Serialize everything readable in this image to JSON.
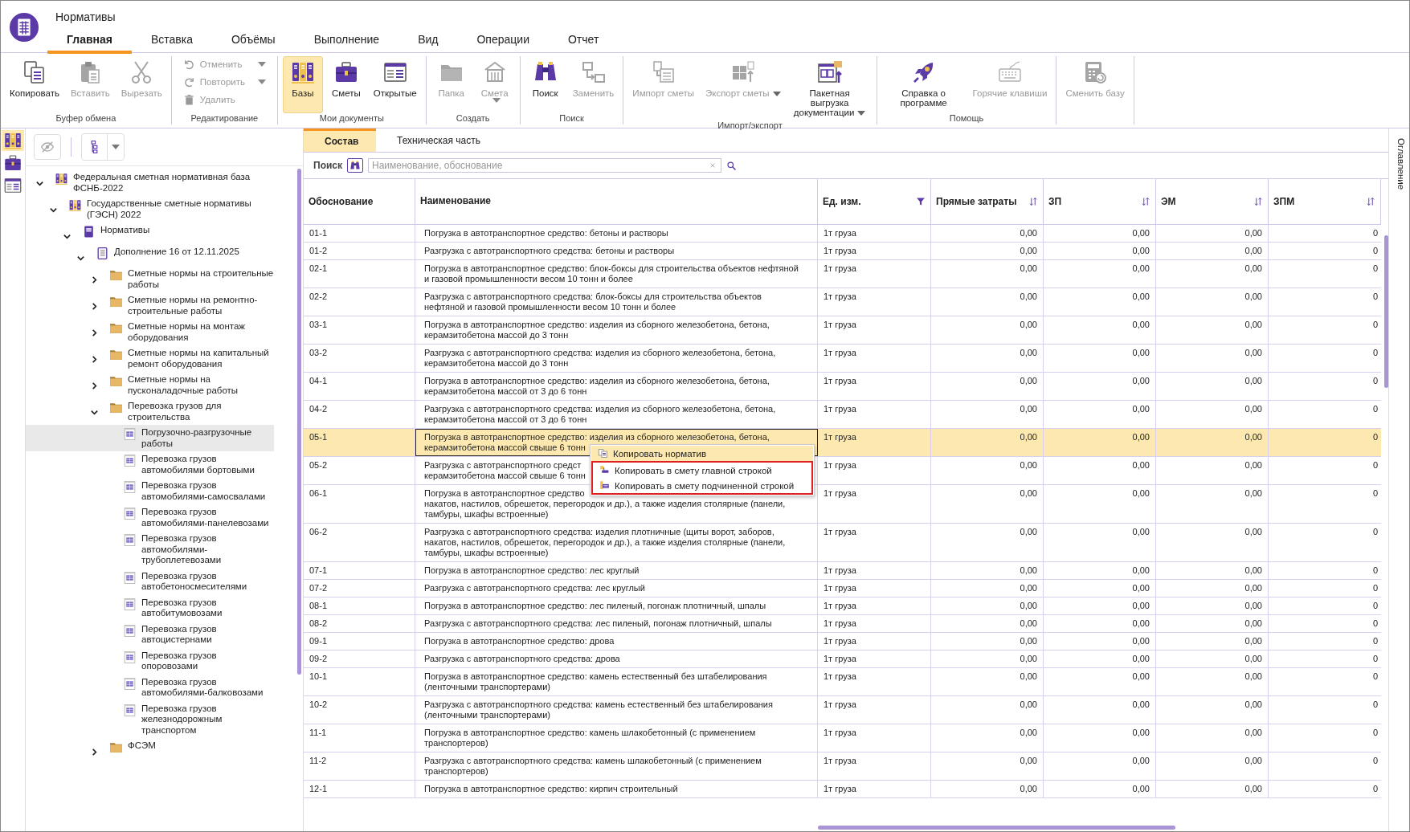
{
  "window": {
    "title": "Нормативы"
  },
  "menu_tabs": [
    {
      "label": "Главная",
      "selected": true
    },
    {
      "label": "Вставка",
      "selected": false
    },
    {
      "label": "Объёмы",
      "selected": false
    },
    {
      "label": "Выполнение",
      "selected": false
    },
    {
      "label": "Вид",
      "selected": false
    },
    {
      "label": "Операции",
      "selected": false
    },
    {
      "label": "Отчет",
      "selected": false
    }
  ],
  "ribbon": [
    {
      "label": "Буфер обмена",
      "kind": "large",
      "buttons": [
        {
          "label": "Копировать",
          "disabled": false,
          "dropdown": false,
          "selected": false
        },
        {
          "label": "Вставить",
          "disabled": true,
          "dropdown": false,
          "selected": false
        },
        {
          "label": "Вырезать",
          "disabled": true,
          "dropdown": false,
          "selected": false
        }
      ]
    },
    {
      "label": "Редактирование",
      "kind": "small",
      "buttons": [
        {
          "label": "Отменить",
          "disabled": true,
          "dropdown": true,
          "selected": false
        },
        {
          "label": "Повторить",
          "disabled": true,
          "dropdown": true,
          "selected": false
        },
        {
          "label": "Удалить",
          "disabled": true,
          "dropdown": false,
          "selected": false
        }
      ]
    },
    {
      "label": "Мои документы",
      "kind": "large",
      "buttons": [
        {
          "label": "Базы",
          "disabled": false,
          "dropdown": false,
          "selected": true
        },
        {
          "label": "Сметы",
          "disabled": false,
          "dropdown": false,
          "selected": false
        },
        {
          "label": "Открытые",
          "disabled": false,
          "dropdown": false,
          "selected": false
        }
      ]
    },
    {
      "label": "Создать",
      "kind": "large",
      "buttons": [
        {
          "label": "Папка",
          "disabled": true,
          "dropdown": false,
          "selected": false
        },
        {
          "label": "Смета",
          "disabled": true,
          "dropdown": true,
          "selected": false
        }
      ]
    },
    {
      "label": "Поиск",
      "kind": "large",
      "buttons": [
        {
          "label": "Поиск",
          "disabled": false,
          "dropdown": false,
          "selected": false
        },
        {
          "label": "Заменить",
          "disabled": true,
          "dropdown": false,
          "selected": false
        }
      ]
    },
    {
      "label": "Импорт/экспорт",
      "kind": "large",
      "buttons": [
        {
          "label": "Импорт сметы",
          "disabled": true,
          "dropdown": false,
          "selected": false
        },
        {
          "label": "Экспорт сметы",
          "disabled": true,
          "dropdown": true,
          "selected": false
        },
        {
          "label": "Пакетная выгрузка документации",
          "disabled": false,
          "dropdown": true,
          "selected": false
        }
      ]
    },
    {
      "label": "Помощь",
      "kind": "large",
      "buttons": [
        {
          "label": "Справка о программе",
          "disabled": false,
          "dropdown": false,
          "selected": false
        },
        {
          "label": "Горячие клавиши",
          "disabled": true,
          "dropdown": false,
          "selected": false
        }
      ]
    },
    {
      "kind": "large",
      "buttons": [
        {
          "label": "Сменить базу",
          "disabled": true,
          "dropdown": false,
          "selected": false
        }
      ]
    }
  ],
  "side_strip": [
    {
      "selected": true
    },
    {
      "selected": false
    },
    {
      "selected": false
    }
  ],
  "tree": [
    {
      "label": "Федеральная сметная нормативная база ФСНБ-2022",
      "kind": "base",
      "expanded": true,
      "children": [
        {
          "label": "Государственные сметные нормативы (ГЭСН) 2022",
          "kind": "base",
          "expanded": true,
          "children": [
            {
              "label": "Нормативы",
              "kind": "book",
              "expanded": true,
              "children": [
                {
                  "label": "Дополнение 16 от 12.11.2025",
                  "kind": "document",
                  "expanded": true,
                  "children": [
                    {
                      "label": "Сметные нормы на строительные работы",
                      "kind": "folder",
                      "expanded": false
                    },
                    {
                      "label": "Сметные нормы на ремонтно-строительные работы",
                      "kind": "folder",
                      "expanded": false
                    },
                    {
                      "label": "Сметные нормы на монтаж оборудования",
                      "kind": "folder",
                      "expanded": false
                    },
                    {
                      "label": "Сметные нормы на капитальный ремонт оборудования",
                      "kind": "folder",
                      "expanded": false
                    },
                    {
                      "label": "Сметные нормы на пусконаладочные работы",
                      "kind": "folder",
                      "expanded": false
                    },
                    {
                      "label": "Перевозка грузов для строительства",
                      "kind": "folder",
                      "expanded": true,
                      "children": [
                        {
                          "label": "Погрузочно-разгрузочные работы",
                          "kind": "table",
                          "selected": true
                        },
                        {
                          "label": "Перевозка грузов автомобилями бортовыми",
                          "kind": "table",
                          "selected": false
                        },
                        {
                          "label": "Перевозка грузов автомобилями-самосвалами",
                          "kind": "table",
                          "selected": false
                        },
                        {
                          "label": "Перевозка грузов автомобилями-панелевозами",
                          "kind": "table",
                          "selected": false
                        },
                        {
                          "label": "Перевозка грузов автомобилями-трубоплетевозами",
                          "kind": "table",
                          "selected": false
                        },
                        {
                          "label": "Перевозка грузов автобетоносмесителями",
                          "kind": "table",
                          "selected": false
                        },
                        {
                          "label": "Перевозка грузов автобитумовозами",
                          "kind": "table",
                          "selected": false
                        },
                        {
                          "label": "Перевозка грузов автоцистернами",
                          "kind": "table",
                          "selected": false
                        },
                        {
                          "label": "Перевозка грузов опоровозами",
                          "kind": "table",
                          "selected": false
                        },
                        {
                          "label": "Перевозка грузов автомобилями-балковозами",
                          "kind": "table",
                          "selected": false
                        },
                        {
                          "label": "Перевозка грузов железнодорожным транспортом",
                          "kind": "table",
                          "selected": false
                        }
                      ]
                    },
                    {
                      "label": "ФСЭМ",
                      "kind": "folder",
                      "expanded": false
                    }
                  ]
                }
              ]
            }
          ]
        }
      ]
    }
  ],
  "content_tabs": [
    {
      "label": "Состав",
      "selected": true
    },
    {
      "label": "Техническая часть",
      "selected": false
    }
  ],
  "search": {
    "label": "Поиск",
    "placeholder": "Наименование, обоснование"
  },
  "table": {
    "columns": [
      {
        "label": "Обоснование"
      },
      {
        "label": "Наименование"
      },
      {
        "label": "Ед. изм.",
        "kind": "filter"
      },
      {
        "label": "Прямые затраты",
        "kind": "sort"
      },
      {
        "label": "ЗП",
        "kind": "sort"
      },
      {
        "label": "ЭМ",
        "kind": "sort"
      },
      {
        "label": "ЗПМ",
        "kind": "sort"
      }
    ],
    "rows": [
      {
        "code": "01-1",
        "name": "Погрузка в автотранспортное средство: бетоны и растворы",
        "unit": "1т груза",
        "values": [
          "0,00",
          "0,00",
          "0,00",
          "0"
        ],
        "selected": false
      },
      {
        "code": "01-2",
        "name": "Разгрузка с автотранспортного средства: бетоны и растворы",
        "unit": "1т груза",
        "values": [
          "0,00",
          "0,00",
          "0,00",
          "0"
        ],
        "selected": false
      },
      {
        "code": "02-1",
        "name": "Погрузка в автотранспортное средство: блок-боксы для строительства объектов нефтяной и газовой промышленности весом 10 тонн и более",
        "unit": "1т груза",
        "values": [
          "0,00",
          "0,00",
          "0,00",
          "0"
        ],
        "selected": false
      },
      {
        "code": "02-2",
        "name": "Разгрузка с автотранспортного средства: блок-боксы для строительства объектов нефтяной и газовой промышленности весом 10 тонн и более",
        "unit": "1т груза",
        "values": [
          "0,00",
          "0,00",
          "0,00",
          "0"
        ],
        "selected": false
      },
      {
        "code": "03-1",
        "name": "Погрузка в автотранспортное средство: изделия из сборного железобетона, бетона, керамзитобетона массой до 3 тонн",
        "unit": "1т груза",
        "values": [
          "0,00",
          "0,00",
          "0,00",
          "0"
        ],
        "selected": false
      },
      {
        "code": "03-2",
        "name": "Разгрузка с автотранспортного средства: изделия из сборного железобетона, бетона, керамзитобетона массой до 3 тонн",
        "unit": "1т груза",
        "values": [
          "0,00",
          "0,00",
          "0,00",
          "0"
        ],
        "selected": false
      },
      {
        "code": "04-1",
        "name": "Погрузка в автотранспортное средство: изделия из сборного железобетона, бетона, керамзитобетона массой от 3 до 6 тонн",
        "unit": "1т груза",
        "values": [
          "0,00",
          "0,00",
          "0,00",
          "0"
        ],
        "selected": false
      },
      {
        "code": "04-2",
        "name": "Разгрузка с автотранспортного средства: изделия из сборного железобетона, бетона, керамзитобетона массой от 3 до 6 тонн",
        "unit": "1т груза",
        "values": [
          "0,00",
          "0,00",
          "0,00",
          "0"
        ],
        "selected": false
      },
      {
        "code": "05-1",
        "name": "Погрузка в автотранспортное средство: изделия из сборного железобетона, бетона, керамзитобетона массой свыше 6 тонн",
        "unit": "1т груза",
        "values": [
          "0,00",
          "0,00",
          "0,00",
          "0"
        ],
        "selected": true
      },
      {
        "code": "05-2",
        "name": "Разгрузка с автотранспортного средст\nкерамзитобетона массой свыше 6 тонн",
        "unit": "1т груза",
        "values": [
          "0,00",
          "0,00",
          "0,00",
          "0"
        ],
        "selected": false
      },
      {
        "code": "06-1",
        "name": "Погрузка в автотранспортное средство\nнакатов, настилов, обрешеток, перегородок и др.), а также изделия столярные (панели, тамбуры, шкафы встроенные)",
        "unit": "1т груза",
        "values": [
          "0,00",
          "0,00",
          "0,00",
          "0"
        ],
        "selected": false
      },
      {
        "code": "06-2",
        "name": "Разгрузка с автотранспортного средства: изделия плотничные (щиты ворот, заборов, накатов, настилов, обрешеток, перегородок и др.), а также изделия столярные (панели, тамбуры, шкафы встроенные)",
        "unit": "1т груза",
        "values": [
          "0,00",
          "0,00",
          "0,00",
          "0"
        ],
        "selected": false
      },
      {
        "code": "07-1",
        "name": "Погрузка в автотранспортное средство: лес круглый",
        "unit": "1т груза",
        "values": [
          "0,00",
          "0,00",
          "0,00",
          "0"
        ],
        "selected": false
      },
      {
        "code": "07-2",
        "name": "Разгрузка с автотранспортного средства: лес круглый",
        "unit": "1т груза",
        "values": [
          "0,00",
          "0,00",
          "0,00",
          "0"
        ],
        "selected": false
      },
      {
        "code": "08-1",
        "name": "Погрузка в автотранспортное средство: лес пиленый, погонаж плотничный, шпалы",
        "unit": "1т груза",
        "values": [
          "0,00",
          "0,00",
          "0,00",
          "0"
        ],
        "selected": false
      },
      {
        "code": "08-2",
        "name": "Разгрузка с автотранспортного средства: лес пиленый, погонаж плотничный, шпалы",
        "unit": "1т груза",
        "values": [
          "0,00",
          "0,00",
          "0,00",
          "0"
        ],
        "selected": false
      },
      {
        "code": "09-1",
        "name": "Погрузка в автотранспортное средство: дрова",
        "unit": "1т груза",
        "values": [
          "0,00",
          "0,00",
          "0,00",
          "0"
        ],
        "selected": false
      },
      {
        "code": "09-2",
        "name": "Разгрузка с автотранспортного средства: дрова",
        "unit": "1т груза",
        "values": [
          "0,00",
          "0,00",
          "0,00",
          "0"
        ],
        "selected": false
      },
      {
        "code": "10-1",
        "name": "Погрузка в автотранспортное средство: камень естественный без штабелирования (ленточными транспортерами)",
        "unit": "1т груза",
        "values": [
          "0,00",
          "0,00",
          "0,00",
          "0"
        ],
        "selected": false
      },
      {
        "code": "10-2",
        "name": "Разгрузка с автотранспортного средства: камень естественный без штабелирования (ленточными транспортерами)",
        "unit": "1т груза",
        "values": [
          "0,00",
          "0,00",
          "0,00",
          "0"
        ],
        "selected": false
      },
      {
        "code": "11-1",
        "name": "Погрузка в автотранспортное средство: камень шлакобетонный (с применением транспортеров)",
        "unit": "1т груза",
        "values": [
          "0,00",
          "0,00",
          "0,00",
          "0"
        ],
        "selected": false
      },
      {
        "code": "11-2",
        "name": "Разгрузка с автотранспортного средства: камень шлакобетонный (с применением транспортеров)",
        "unit": "1т груза",
        "values": [
          "0,00",
          "0,00",
          "0,00",
          "0"
        ],
        "selected": false
      },
      {
        "code": "12-1",
        "name": "Погрузка в автотранспортное средство: кирпич строительный",
        "unit": "1т груза",
        "values": [
          "0,00",
          "0,00",
          "0,00",
          "0"
        ],
        "selected": false
      }
    ]
  },
  "context_menu": {
    "items": [
      {
        "label": "Копировать норматив",
        "selected": true,
        "framed": false
      },
      {
        "label": "Копировать в смету главной строкой",
        "selected": false,
        "framed": true
      },
      {
        "label": "Копировать в смету подчиненной строкой",
        "selected": false,
        "framed": true
      }
    ]
  },
  "side_tab": {
    "label": "Оглавление"
  }
}
